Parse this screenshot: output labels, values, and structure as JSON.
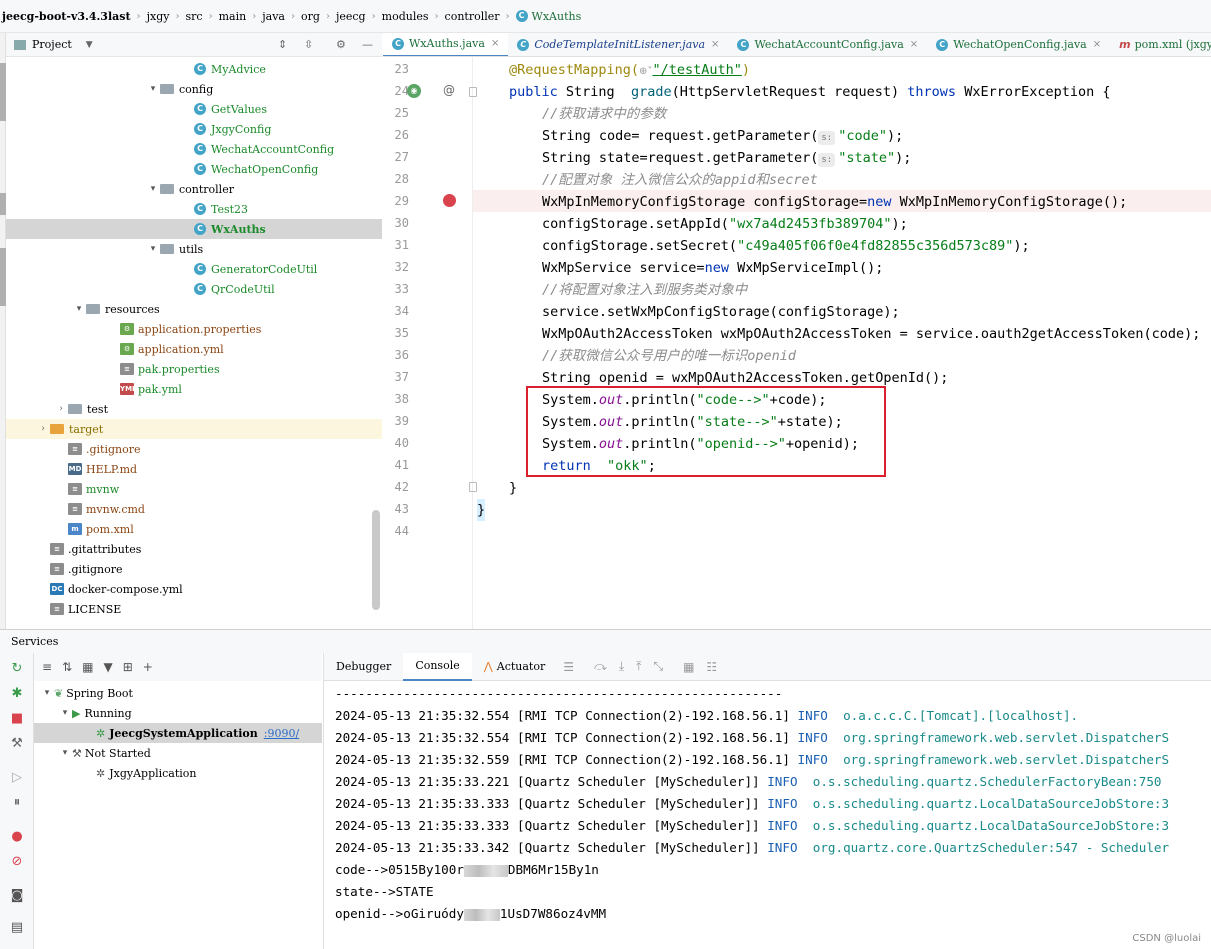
{
  "breadcrumb": [
    "jeecg-boot-v3.4.3last",
    "jxgy",
    "src",
    "main",
    "java",
    "org",
    "jeecg",
    "modules",
    "controller",
    "WxAuths"
  ],
  "project_panel": {
    "title": "Project"
  },
  "tree": [
    {
      "label": "MyAdvice",
      "type": "class",
      "indent": 188
    },
    {
      "label": "config",
      "type": "folder",
      "indent": 154,
      "arrow": "▾"
    },
    {
      "label": "GetValues",
      "type": "class",
      "indent": 188
    },
    {
      "label": "JxgyConfig",
      "type": "class",
      "indent": 188
    },
    {
      "label": "WechatAccountConfig",
      "type": "class",
      "indent": 188
    },
    {
      "label": "WechatOpenConfig",
      "type": "class",
      "indent": 188
    },
    {
      "label": "controller",
      "type": "folder",
      "indent": 154,
      "arrow": "▾"
    },
    {
      "label": "Test23",
      "type": "class",
      "indent": 188
    },
    {
      "label": "WxAuths",
      "type": "class",
      "indent": 188,
      "selected": true
    },
    {
      "label": "utils",
      "type": "folder",
      "indent": 154,
      "arrow": "▾"
    },
    {
      "label": "GeneratorCodeUtil",
      "type": "class",
      "indent": 188
    },
    {
      "label": "QrCodeUtil",
      "type": "class",
      "indent": 188
    },
    {
      "label": "resources",
      "type": "folder",
      "indent": 80,
      "arrow": "▾"
    },
    {
      "label": "application.properties",
      "type": "prop",
      "indent": 114
    },
    {
      "label": "application.yml",
      "type": "prop",
      "indent": 114
    },
    {
      "label": "pak.properties",
      "type": "file",
      "indent": 114
    },
    {
      "label": "pak.yml",
      "type": "yml",
      "indent": 114
    },
    {
      "label": "test",
      "type": "folder",
      "indent": 62,
      "arrow": "›"
    },
    {
      "label": "target",
      "type": "folder-orange",
      "indent": 44,
      "arrow": "›",
      "target": true
    },
    {
      "label": ".gitignore",
      "type": "file",
      "indent": 62
    },
    {
      "label": "HELP.md",
      "type": "md",
      "indent": 62
    },
    {
      "label": "mvnw",
      "type": "file",
      "indent": 62
    },
    {
      "label": "mvnw.cmd",
      "type": "file",
      "indent": 62
    },
    {
      "label": "pom.xml",
      "type": "maven",
      "indent": 62
    },
    {
      "label": ".gitattributes",
      "type": "file",
      "indent": 44
    },
    {
      "label": ".gitignore",
      "type": "file",
      "indent": 44
    },
    {
      "label": "docker-compose.yml",
      "type": "docker",
      "indent": 44
    },
    {
      "label": "LICENSE",
      "type": "file",
      "indent": 44
    }
  ],
  "tabs": [
    {
      "label": "WxAuths.java",
      "active": true
    },
    {
      "label": "CodeTemplateInitListener.java",
      "italic": true
    },
    {
      "label": "WechatAccountConfig.java"
    },
    {
      "label": "WechatOpenConfig.java"
    },
    {
      "label": "pom.xml (jxgy)"
    }
  ],
  "line_numbers": [
    "23",
    "24",
    "25",
    "26",
    "27",
    "28",
    "29",
    "30",
    "31",
    "32",
    "33",
    "34",
    "35",
    "36",
    "37",
    "38",
    "39",
    "40",
    "41",
    "42",
    "43",
    "44"
  ],
  "code": {
    "l23_ann": "@RequestMapping(",
    "l23_url": "\"/testAuth\"",
    "l23_close": ")",
    "l24_public": "public",
    "l24_mid": " String  ",
    "l24_fn": "grade",
    "l24_args": "(HttpServletRequest request) ",
    "l24_throws": "throws",
    "l24_end": " WxErrorException {",
    "l25": "//获取请求中的参数",
    "l26_a": "String code= request.getParameter(",
    "l26_hint": "s:",
    "l26_str": "\"code\"",
    "l26_end": ");",
    "l27_a": "String state=request.getParameter(",
    "l27_hint": "s:",
    "l27_str": "\"state\"",
    "l27_end": ");",
    "l28": "//配置对象 注入微信公众的appid和secret",
    "l29_a": "WxMpInMemoryConfigStorage configStorage=",
    "l29_new": "new",
    "l29_b": " WxMpInMemoryConfigStorage();",
    "l30_a": "configStorage.setAppId(",
    "l30_str": "\"wx7a4d2453fb389704\"",
    "l30_end": ");",
    "l31_a": "configStorage.setSecret(",
    "l31_str": "\"c49a405f06f0e4fd82855c356d573c89\"",
    "l31_end": ");",
    "l32_a": "WxMpService service=",
    "l32_new": "new",
    "l32_b": " WxMpServiceImpl();",
    "l33": "//将配置对象注入到服务类对象中",
    "l34": "service.setWxMpConfigStorage(configStorage);",
    "l35": "WxMpOAuth2AccessToken wxMpOAuth2AccessToken = service.oauth2getAccessToken(code);",
    "l36": "//获取微信公众号用户的唯一标识openid",
    "l37": "String openid = wxMpOAuth2AccessToken.getOpenId();",
    "l38_sys": "System.",
    "l38_out": "out",
    "l38_mid": ".println(",
    "l38_str": "\"code-->\"",
    "l38_end": "+code);",
    "l39_sys": "System.",
    "l39_out": "out",
    "l39_mid": ".println(",
    "l39_str": "\"state-->\"",
    "l39_end": "+state);",
    "l40_sys": "System.",
    "l40_out": "out",
    "l40_mid": ".println(",
    "l40_str": "\"openid-->\"",
    "l40_end": "+openid);",
    "l41_ret": "return",
    "l41_str": "\"okk\"",
    "l41_end": ";",
    "l42": "}",
    "l43": "}"
  },
  "services": {
    "title": "Services",
    "spring_boot": "Spring Boot",
    "running": "Running",
    "app1": "JeecgSystemApplication",
    "app1_port": ":9090/",
    "not_started": "Not Started",
    "app2": "JxgyApplication"
  },
  "console_tabs": [
    "Debugger",
    "Console",
    "Actuator"
  ],
  "console": {
    "sep": "-----------------------------------------------------------",
    "lines": [
      {
        "time": "2024-05-13 21:35:32.554",
        "thread": "[RMI TCP Connection(2)-192.168.56.1]",
        "level": "INFO",
        "logger": "o.a.c.c.C.[Tomcat].[localhost]."
      },
      {
        "time": "2024-05-13 21:35:32.554",
        "thread": "[RMI TCP Connection(2)-192.168.56.1]",
        "level": "INFO",
        "logger": "org.springframework.web.servlet.DispatcherS"
      },
      {
        "time": "2024-05-13 21:35:32.559",
        "thread": "[RMI TCP Connection(2)-192.168.56.1]",
        "level": "INFO",
        "logger": "org.springframework.web.servlet.DispatcherS"
      },
      {
        "time": "2024-05-13 21:35:33.221",
        "thread": "[Quartz Scheduler [MyScheduler]]",
        "level": "INFO",
        "logger": "o.s.scheduling.quartz.SchedulerFactoryBean:750"
      },
      {
        "time": "2024-05-13 21:35:33.333",
        "thread": "[Quartz Scheduler [MyScheduler]]",
        "level": "INFO",
        "logger": "o.s.scheduling.quartz.LocalDataSourceJobStore:3"
      },
      {
        "time": "2024-05-13 21:35:33.333",
        "thread": "[Quartz Scheduler [MyScheduler]]",
        "level": "INFO",
        "logger": "o.s.scheduling.quartz.LocalDataSourceJobStore:3"
      },
      {
        "time": "2024-05-13 21:35:33.342",
        "thread": "[Quartz Scheduler [MyScheduler]]",
        "level": "INFO",
        "logger": "org.quartz.core.QuartzScheduler:547 - Scheduler"
      }
    ],
    "code_a": "code-->0515By100r",
    "code_b": "DBM6Mr15By1n",
    "state": "state-->STATE",
    "openid_a": "openid-->oGiruódy",
    "openid_b": "1UsD7W86oz4vMM"
  },
  "watermark": "CSDN @luolai"
}
